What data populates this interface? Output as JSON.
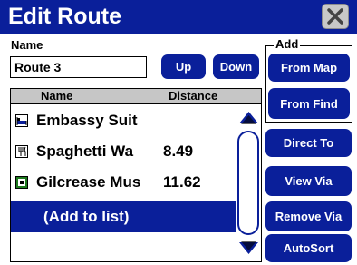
{
  "window": {
    "title": "Edit Route"
  },
  "name_field": {
    "label": "Name",
    "value": "Route 3"
  },
  "buttons": {
    "up": "Up",
    "down": "Down",
    "from_map": "From Map",
    "from_find": "From Find",
    "direct_to": "Direct To",
    "view_via": "View Via",
    "remove_via": "Remove Via",
    "autosort": "AutoSort"
  },
  "add_group": {
    "label": "Add"
  },
  "list": {
    "columns": {
      "name": "Name",
      "distance": "Distance"
    },
    "rows": [
      {
        "name": "Embassy Suit",
        "distance": "",
        "icon": "hotel-icon"
      },
      {
        "name": "Spaghetti Wa",
        "distance": "8.49",
        "icon": "restaurant-icon"
      },
      {
        "name": "Gilcrease Mus",
        "distance": "11.62",
        "icon": "museum-icon"
      }
    ],
    "add_item": "(Add to list)"
  },
  "colors": {
    "accent": "#0a1f9a",
    "header_bg": "#c6c6c6"
  }
}
